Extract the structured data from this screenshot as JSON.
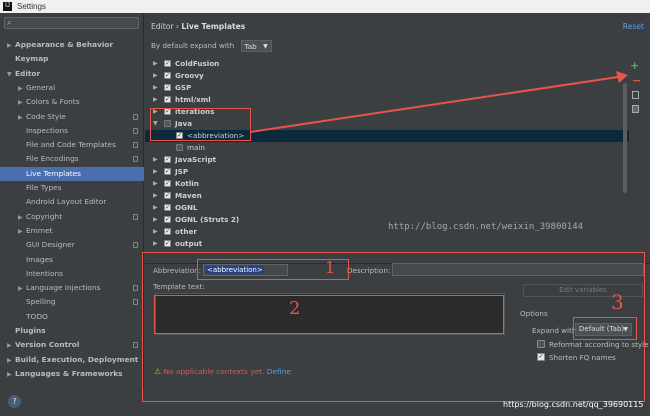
{
  "window": {
    "title": "Settings",
    "app_icon": "intellij-icon"
  },
  "sidebar": {
    "search_placeholder": "",
    "items": [
      {
        "label": "Appearance & Behavior",
        "bold": true,
        "arrow": "▶",
        "indent": 0
      },
      {
        "label": "Keymap",
        "bold": true,
        "arrow": "",
        "indent": 0
      },
      {
        "label": "Editor",
        "bold": true,
        "arrow": "▼",
        "indent": 0
      },
      {
        "label": "General",
        "arrow": "▶",
        "indent": 1
      },
      {
        "label": "Colors & Fonts",
        "arrow": "▶",
        "indent": 1
      },
      {
        "label": "Code Style",
        "arrow": "▶",
        "indent": 1,
        "proj": true
      },
      {
        "label": "Inspections",
        "arrow": "",
        "indent": 1,
        "proj": true
      },
      {
        "label": "File and Code Templates",
        "arrow": "",
        "indent": 1,
        "proj": true
      },
      {
        "label": "File Encodings",
        "arrow": "",
        "indent": 1,
        "proj": true
      },
      {
        "label": "Live Templates",
        "arrow": "",
        "indent": 1,
        "selected": true
      },
      {
        "label": "File Types",
        "arrow": "",
        "indent": 1
      },
      {
        "label": "Android Layout Editor",
        "arrow": "",
        "indent": 1
      },
      {
        "label": "Copyright",
        "arrow": "▶",
        "indent": 1,
        "proj": true
      },
      {
        "label": "Emmet",
        "arrow": "▶",
        "indent": 1
      },
      {
        "label": "GUI Designer",
        "arrow": "",
        "indent": 1,
        "proj": true
      },
      {
        "label": "Images",
        "arrow": "",
        "indent": 1
      },
      {
        "label": "Intentions",
        "arrow": "",
        "indent": 1
      },
      {
        "label": "Language Injections",
        "arrow": "▶",
        "indent": 1,
        "proj": true
      },
      {
        "label": "Spelling",
        "arrow": "",
        "indent": 1,
        "proj": true
      },
      {
        "label": "TODO",
        "arrow": "",
        "indent": 1
      },
      {
        "label": "Plugins",
        "bold": true,
        "arrow": "",
        "indent": 0
      },
      {
        "label": "Version Control",
        "bold": true,
        "arrow": "▶",
        "indent": 0,
        "proj": true
      },
      {
        "label": "Build, Execution, Deployment",
        "bold": true,
        "arrow": "▶",
        "indent": 0
      },
      {
        "label": "Languages & Frameworks",
        "bold": true,
        "arrow": "▶",
        "indent": 0
      }
    ],
    "help_label": "?"
  },
  "main": {
    "breadcrumb_section": "Editor",
    "breadcrumb_sep": "›",
    "breadcrumb_page": "Live Templates",
    "reset_label": "Reset",
    "expand_label": "By default expand with",
    "expand_value": "Tab",
    "templates": [
      {
        "label": "ColdFusion",
        "bold": true,
        "arrow": "▶",
        "checked": true,
        "level": 0
      },
      {
        "label": "Groovy",
        "bold": true,
        "arrow": "▶",
        "checked": true,
        "level": 0
      },
      {
        "label": "GSP",
        "bold": true,
        "arrow": "▶",
        "checked": true,
        "level": 0
      },
      {
        "label": "html/xml",
        "bold": true,
        "arrow": "▶",
        "checked": true,
        "level": 0
      },
      {
        "label": "iterations",
        "bold": true,
        "arrow": "▶",
        "checked": true,
        "level": 0
      },
      {
        "label": "Java",
        "bold": true,
        "arrow": "▼",
        "checked": false,
        "level": 0
      },
      {
        "label": "<abbreviation>",
        "bold": false,
        "arrow": "",
        "checked": true,
        "level": 1,
        "selected": true
      },
      {
        "label": "main",
        "bold": false,
        "arrow": "",
        "checked": false,
        "level": 1
      },
      {
        "label": "JavaScript",
        "bold": true,
        "arrow": "▶",
        "checked": true,
        "level": 0
      },
      {
        "label": "JSP",
        "bold": true,
        "arrow": "▶",
        "checked": true,
        "level": 0
      },
      {
        "label": "Kotlin",
        "bold": true,
        "arrow": "▶",
        "checked": true,
        "level": 0
      },
      {
        "label": "Maven",
        "bold": true,
        "arrow": "▶",
        "checked": true,
        "level": 0
      },
      {
        "label": "OGNL",
        "bold": true,
        "arrow": "▶",
        "checked": true,
        "level": 0
      },
      {
        "label": "OGNL (Struts 2)",
        "bold": true,
        "arrow": "▶",
        "checked": true,
        "level": 0
      },
      {
        "label": "other",
        "bold": true,
        "arrow": "▶",
        "checked": true,
        "level": 0
      },
      {
        "label": "output",
        "bold": true,
        "arrow": "▶",
        "checked": true,
        "level": 0
      }
    ],
    "tools": {
      "add": "+",
      "remove": "−"
    },
    "watermark": "http://blog.csdn.net/weixin_39800144",
    "form": {
      "abbreviation_label": "Abbreviation:",
      "abbreviation_value": "<abbreviation>",
      "description_label": "Description:",
      "description_value": "",
      "template_text_label": "Template text:",
      "template_text_value": "",
      "edit_variables_label": "Edit variables",
      "options_label": "Options",
      "expand_with_label": "Expand with",
      "expand_with_value": "Default (Tab)",
      "reformat_label": "Reformat according to style",
      "reformat_checked": false,
      "shorten_label": "Shorten FQ names",
      "shorten_checked": true
    },
    "warning_text": "No applicable contexts yet.",
    "define_label": "Define"
  },
  "annotations": {
    "one": "1",
    "two": "2",
    "three": "3",
    "color": "#e8534a"
  },
  "footer": {
    "url_text": "https://blog.csdn.net/qq_39690115"
  }
}
